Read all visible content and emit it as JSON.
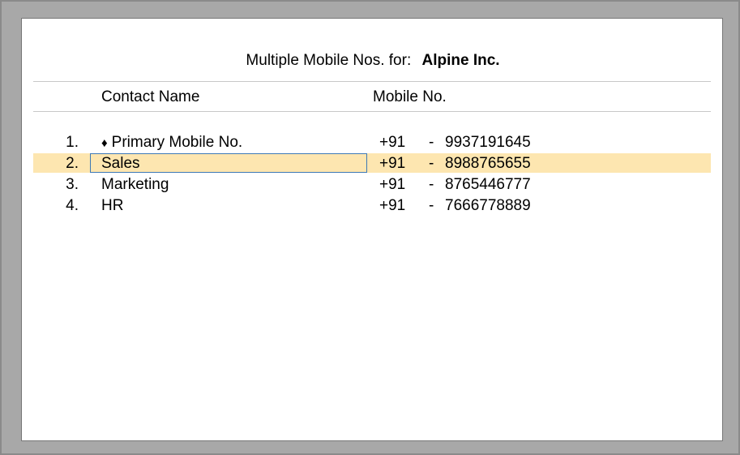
{
  "header": {
    "title_prefix": "Multiple Mobile Nos. for:",
    "company": "Alpine Inc."
  },
  "columns": {
    "contact_name": "Contact Name",
    "mobile_no": "Mobile No."
  },
  "primary_marker": "♦",
  "rows": [
    {
      "num": "1.",
      "name": "Primary Mobile No.",
      "code": "+91",
      "separator": "-",
      "mobile": "9937191645"
    },
    {
      "num": "2.",
      "name": "Sales",
      "code": "+91",
      "separator": "-",
      "mobile": "8988765655"
    },
    {
      "num": "3.",
      "name": "Marketing",
      "code": "+91",
      "separator": "-",
      "mobile": "8765446777"
    },
    {
      "num": "4.",
      "name": "HR",
      "code": "+91",
      "separator": "-",
      "mobile": "7666778889"
    }
  ],
  "colors": {
    "selected_row": "#fde6b0",
    "focus_border": "#3d78b5"
  }
}
